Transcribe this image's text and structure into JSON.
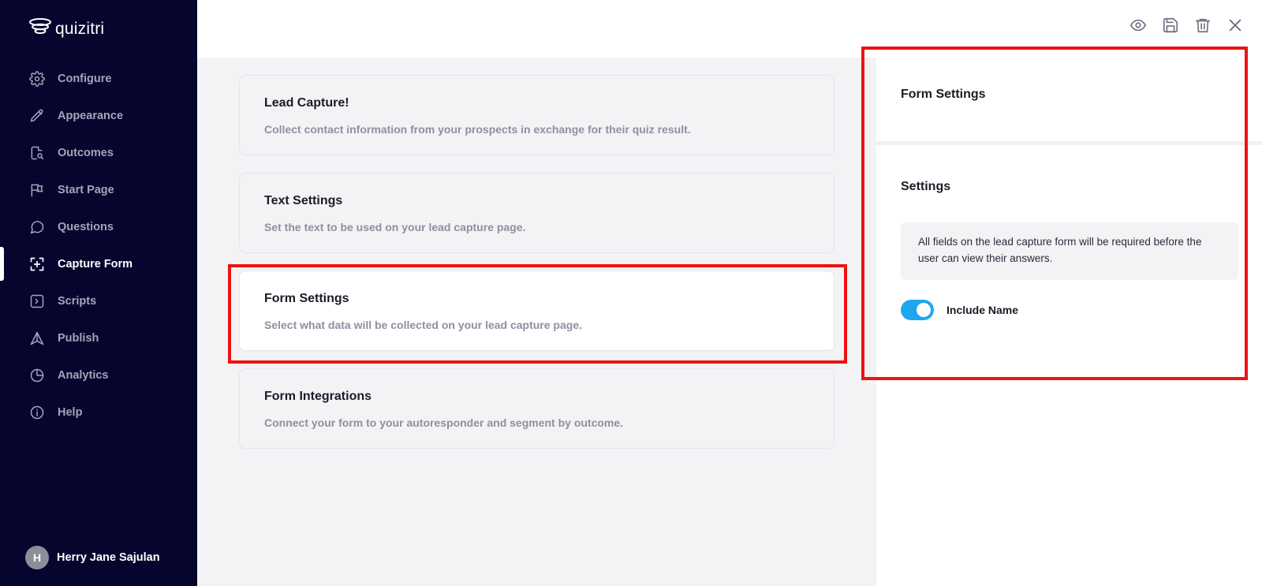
{
  "app": {
    "name": "quizitri"
  },
  "sidebar": {
    "items": [
      {
        "label": "Configure",
        "icon": "gear-icon",
        "active": false
      },
      {
        "label": "Appearance",
        "icon": "pencil-icon",
        "active": false
      },
      {
        "label": "Outcomes",
        "icon": "document-search-icon",
        "active": false
      },
      {
        "label": "Start Page",
        "icon": "flag-icon",
        "active": false
      },
      {
        "label": "Questions",
        "icon": "chat-bubble-icon",
        "active": false
      },
      {
        "label": "Capture Form",
        "icon": "capture-icon",
        "active": true
      },
      {
        "label": "Scripts",
        "icon": "terminal-icon",
        "active": false
      },
      {
        "label": "Publish",
        "icon": "rocket-icon",
        "active": false
      },
      {
        "label": "Analytics",
        "icon": "pie-chart-icon",
        "active": false
      },
      {
        "label": "Help",
        "icon": "info-icon",
        "active": false
      }
    ],
    "user": {
      "initial": "H",
      "name": "Herry Jane Sajulan"
    }
  },
  "toolbar": {
    "actions": [
      "eye-icon",
      "save-icon",
      "trash-icon",
      "close-icon"
    ]
  },
  "cards": [
    {
      "title": "Lead Capture!",
      "description": "Collect contact information from your prospects in exchange for their quiz result.",
      "selected": false
    },
    {
      "title": "Text Settings",
      "description": "Set the text to be used on your lead capture page.",
      "selected": false
    },
    {
      "title": "Form Settings",
      "description": "Select what data will be collected on your lead capture page.",
      "selected": true
    },
    {
      "title": "Form Integrations",
      "description": "Connect your form to your autoresponder and segment by outcome.",
      "selected": false
    }
  ],
  "panel": {
    "title": "Form Settings",
    "section_title": "Settings",
    "notice": "All fields on the lead capture form will be required before the user can view their answers.",
    "toggle": {
      "label": "Include Name",
      "on": true
    }
  },
  "colors": {
    "sidebar_bg": "#05052e",
    "accent_toggle": "#1ea7ee",
    "highlight": "#ee1212",
    "content_bg": "#f3f3f6"
  }
}
